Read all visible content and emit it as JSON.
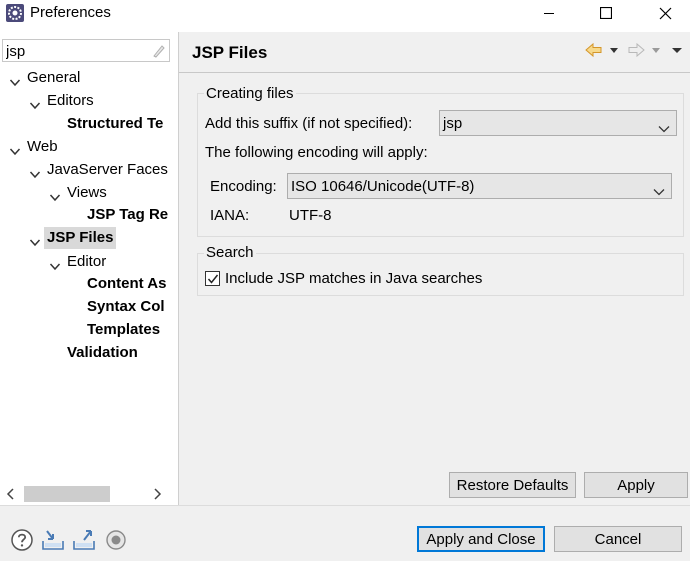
{
  "window": {
    "title": "Preferences"
  },
  "filter": {
    "value": "jsp"
  },
  "tree": [
    {
      "label": "General",
      "bold": false,
      "arrow": "down"
    },
    {
      "label": "Editors",
      "bold": false,
      "arrow": "down"
    },
    {
      "label": "Structured Te",
      "bold": true,
      "arrow": ""
    },
    {
      "label": "Web",
      "bold": false,
      "arrow": "down"
    },
    {
      "label": "JavaServer Faces",
      "bold": false,
      "arrow": "down"
    },
    {
      "label": "Views",
      "bold": false,
      "arrow": "down"
    },
    {
      "label": "JSP Tag Re",
      "bold": true,
      "arrow": ""
    },
    {
      "label": "JSP Files",
      "bold": true,
      "arrow": "down",
      "selected": true
    },
    {
      "label": "Editor",
      "bold": false,
      "arrow": "down"
    },
    {
      "label": "Content As",
      "bold": true,
      "arrow": ""
    },
    {
      "label": "Syntax Col",
      "bold": true,
      "arrow": ""
    },
    {
      "label": "Templates",
      "bold": true,
      "arrow": ""
    },
    {
      "label": "Validation",
      "bold": true,
      "arrow": ""
    }
  ],
  "page": {
    "title": "JSP Files",
    "creating": {
      "group_label": "Creating files",
      "suffix_label": "Add this suffix (if not specified):",
      "suffix_value": "jsp",
      "encoding_note": "The following encoding will apply:",
      "encoding_label": "Encoding:",
      "encoding_value": "ISO 10646/Unicode(UTF-8)",
      "iana_label": "IANA:",
      "iana_value": "UTF-8"
    },
    "search": {
      "group_label": "Search",
      "include_label": "Include JSP matches in Java searches",
      "include_checked": true
    },
    "restore_defaults": "Restore Defaults",
    "apply": "Apply"
  },
  "footer": {
    "apply_and_close": "Apply and Close",
    "cancel": "Cancel"
  },
  "colors": {
    "panel_bg": "#f0f0f0",
    "selection_bg": "#d9d9d9",
    "default_button_border": "#0078d7",
    "nav_back_arrow": "#e8a832"
  }
}
